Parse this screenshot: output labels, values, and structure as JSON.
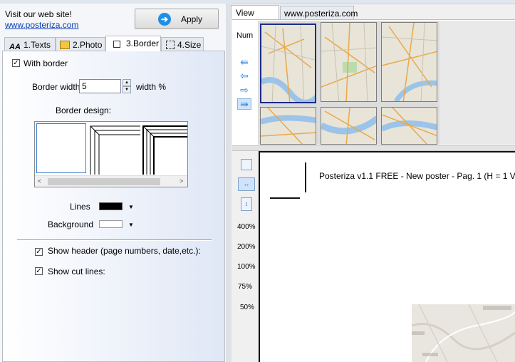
{
  "promo": {
    "line1": "Visit our web site!",
    "link": "www.posteriza.com"
  },
  "apply": {
    "label": "Apply"
  },
  "tabs": [
    {
      "label": "1.Texts"
    },
    {
      "label": "2.Photo"
    },
    {
      "label": "3.Border"
    },
    {
      "label": "4.Size"
    }
  ],
  "active_tab": "3.Border",
  "border": {
    "with_border_label": "With border",
    "with_border_checked": true,
    "width_label": "Border width",
    "width_value": "5",
    "width_unit": "width %",
    "design_label": "Border design:",
    "lines_label": "Lines",
    "lines_color": "#000000",
    "background_label": "Background",
    "background_color": "#ffffff",
    "show_header_label": "Show header (page numbers, date,etc.):",
    "show_header_checked": true,
    "show_cut_label": "Show cut lines:",
    "show_cut_checked": true
  },
  "right_tabs": [
    {
      "label": "View Poster"
    },
    {
      "label": "www.posteriza.com"
    }
  ],
  "num_label": "Num",
  "zoom_levels": [
    "400%",
    "200%",
    "100%",
    "75%",
    "50%"
  ],
  "preview": {
    "header_text": "Posteriza v1.1 FREE - New poster - Pag. 1 (H = 1  V"
  },
  "icons": [
    "arrow-right-icon",
    "texts-icon",
    "photo-icon",
    "border-icon",
    "size-icon",
    "double-arrow-left-icon",
    "arrow-left-icon",
    "arrow-right-icon",
    "double-arrow-right-icon",
    "single-page-icon",
    "fit-width-icon",
    "fit-height-icon",
    "spin-up-icon",
    "spin-down-icon",
    "dropdown-arrow-icon"
  ],
  "colors": {
    "accent": "#1f8fe6",
    "link": "#0a3cb4",
    "selected_thumb_border": "#1b2b88"
  }
}
